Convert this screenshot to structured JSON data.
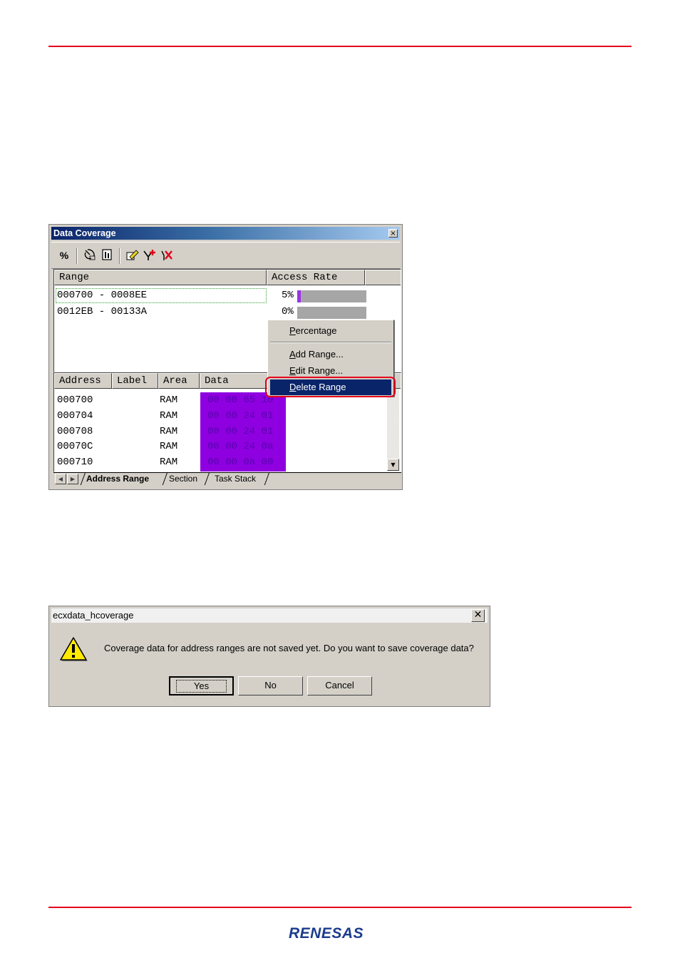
{
  "data_coverage_window": {
    "title": "Data Coverage",
    "close_glyph": "×",
    "toolbar": {
      "percent_label": "%"
    },
    "range_table": {
      "headers": [
        "Range",
        "Access Rate"
      ],
      "rows": [
        {
          "range": "000700 - 0008EE",
          "rate": "5%",
          "rate_value": 5
        },
        {
          "range": "0012EB - 00133A",
          "rate": "0%",
          "rate_value": 0
        }
      ]
    },
    "memory_table": {
      "headers": [
        "Address",
        "Label",
        "Area",
        "Data"
      ],
      "rows": [
        {
          "address": "000700",
          "label": "",
          "area": "RAM",
          "data": "00  00  65  10"
        },
        {
          "address": "000704",
          "label": "",
          "area": "RAM",
          "data": "00  00  24  01"
        },
        {
          "address": "000708",
          "label": "",
          "area": "RAM",
          "data": "00  00  24  01"
        },
        {
          "address": "00070C",
          "label": "",
          "area": "RAM",
          "data": "00  00  24  0a"
        },
        {
          "address": "000710",
          "label": "",
          "area": "RAM",
          "data": "00  00  0a  00"
        }
      ]
    },
    "tabs": [
      "Address Range",
      "Section",
      "Task Stack"
    ],
    "active_tab": "Address Range"
  },
  "context_menu": {
    "items": [
      {
        "label": "Percentage",
        "mnemonic": "P"
      },
      {
        "label": "Add Range...",
        "mnemonic": "A"
      },
      {
        "label": "Edit Range...",
        "mnemonic": "E"
      },
      {
        "label": "Delete Range",
        "mnemonic": "D"
      }
    ],
    "selected": "Delete Range"
  },
  "dialog": {
    "title": "ecxdata_hcoverage",
    "message": "Coverage data for address ranges are not saved yet. Do you want to save coverage data?",
    "buttons": {
      "yes": "Yes",
      "no": "No",
      "cancel": "Cancel"
    },
    "default_button": "Yes"
  },
  "brand": {
    "logo_text": "RENESAS",
    "accent_color": "#e4001b"
  }
}
